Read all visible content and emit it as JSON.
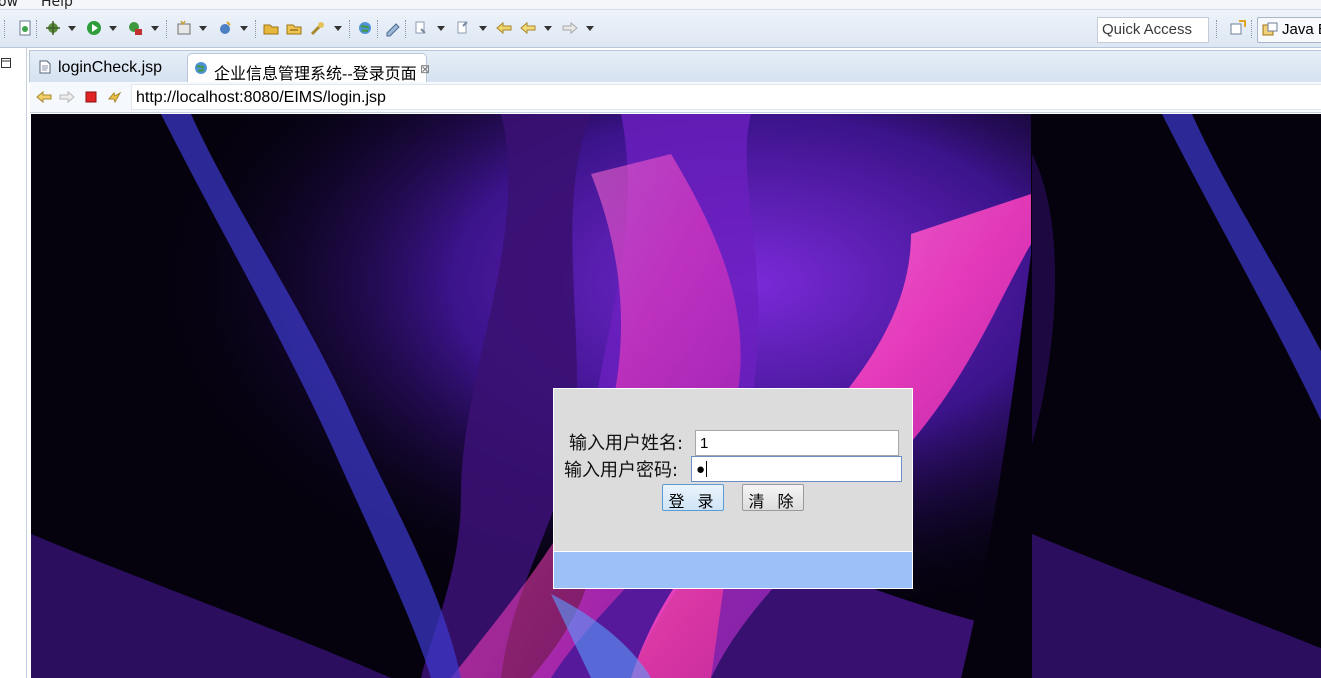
{
  "menu": {
    "items": [
      "ow",
      "Help"
    ]
  },
  "toolbar": {
    "quick_access_placeholder": "Quick Access",
    "perspective_label": "Java E"
  },
  "editor": {
    "tabs": [
      {
        "label": "loginCheck.jsp",
        "active": false
      },
      {
        "label": "企业信息管理系统--登录页面",
        "active": true
      }
    ],
    "close_glyph": "⊠"
  },
  "browser": {
    "url": "http://localhost:8080/EIMS/login.jsp"
  },
  "login_form": {
    "username_label": "输入用户姓名:",
    "username_value": "1",
    "password_label": "输入用户密码:",
    "password_value": "●",
    "login_button": "登 录",
    "clear_button": "清 除"
  },
  "colors": {
    "panel_bg": "#dcdcdc",
    "panel_footer": "#9cc0f8",
    "page_bg": "#05020e",
    "flame_pink": "#ff66cc",
    "flame_violet": "#6a1fd6"
  }
}
